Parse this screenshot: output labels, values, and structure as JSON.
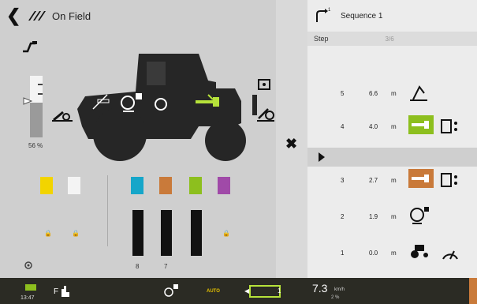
{
  "left": {
    "back_icon": "chevron-left-icon",
    "logo_icon": "brand-logo-icon",
    "title": "On Field",
    "hitch_percent": "56 %",
    "counter_8": "8",
    "counter_7": "7"
  },
  "close_icon": "close-icon",
  "right": {
    "sequence_title": "Sequence 1",
    "step_label": "Step",
    "step_count": "3/6",
    "items": [
      {
        "num": "5",
        "dist": "6.6",
        "unit": "m",
        "icon1": "hitch-lift-icon",
        "icon2": ""
      },
      {
        "num": "4",
        "dist": "4.0",
        "unit": "m",
        "icon1": "valve-icon",
        "icon2": "valve-control-icon"
      },
      {
        "num": "3",
        "dist": "2.7",
        "unit": "m",
        "icon1": "valve-icon",
        "icon2": "valve-control-icon"
      },
      {
        "num": "2",
        "dist": "1.9",
        "unit": "m",
        "icon1": "pto-icon",
        "icon2": ""
      },
      {
        "num": "1",
        "dist": "0.0",
        "unit": "m",
        "icon1": "tractor-icon",
        "icon2": "speed-gauge-icon"
      }
    ]
  },
  "bottom": {
    "clock": "13:47",
    "auto_label": "AUTO",
    "gear_label": "1",
    "speed_value": "7.3",
    "speed_unit": "km/h",
    "slip": "2 %"
  },
  "colors": {
    "yellow": "#f2d400",
    "cyan": "#16a6c9",
    "orange": "#c97a3a",
    "green": "#8dbf1e",
    "purple": "#a04aa8"
  }
}
